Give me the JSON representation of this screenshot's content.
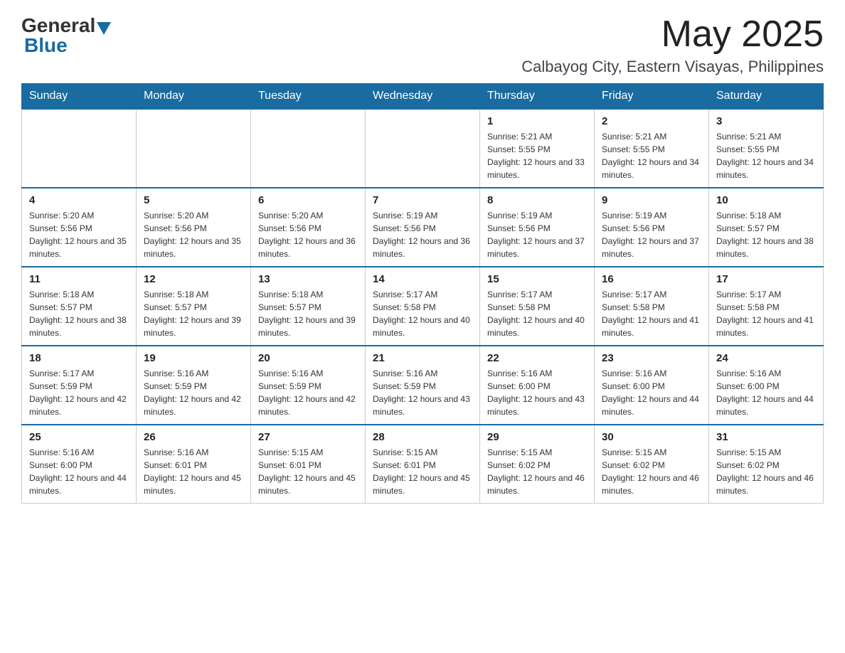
{
  "header": {
    "logo_general": "General",
    "logo_blue": "Blue",
    "month_title": "May 2025",
    "location": "Calbayog City, Eastern Visayas, Philippines"
  },
  "weekdays": [
    "Sunday",
    "Monday",
    "Tuesday",
    "Wednesday",
    "Thursday",
    "Friday",
    "Saturday"
  ],
  "weeks": [
    [
      {
        "day": "",
        "sunrise": "",
        "sunset": "",
        "daylight": ""
      },
      {
        "day": "",
        "sunrise": "",
        "sunset": "",
        "daylight": ""
      },
      {
        "day": "",
        "sunrise": "",
        "sunset": "",
        "daylight": ""
      },
      {
        "day": "",
        "sunrise": "",
        "sunset": "",
        "daylight": ""
      },
      {
        "day": "1",
        "sunrise": "Sunrise: 5:21 AM",
        "sunset": "Sunset: 5:55 PM",
        "daylight": "Daylight: 12 hours and 33 minutes."
      },
      {
        "day": "2",
        "sunrise": "Sunrise: 5:21 AM",
        "sunset": "Sunset: 5:55 PM",
        "daylight": "Daylight: 12 hours and 34 minutes."
      },
      {
        "day": "3",
        "sunrise": "Sunrise: 5:21 AM",
        "sunset": "Sunset: 5:55 PM",
        "daylight": "Daylight: 12 hours and 34 minutes."
      }
    ],
    [
      {
        "day": "4",
        "sunrise": "Sunrise: 5:20 AM",
        "sunset": "Sunset: 5:56 PM",
        "daylight": "Daylight: 12 hours and 35 minutes."
      },
      {
        "day": "5",
        "sunrise": "Sunrise: 5:20 AM",
        "sunset": "Sunset: 5:56 PM",
        "daylight": "Daylight: 12 hours and 35 minutes."
      },
      {
        "day": "6",
        "sunrise": "Sunrise: 5:20 AM",
        "sunset": "Sunset: 5:56 PM",
        "daylight": "Daylight: 12 hours and 36 minutes."
      },
      {
        "day": "7",
        "sunrise": "Sunrise: 5:19 AM",
        "sunset": "Sunset: 5:56 PM",
        "daylight": "Daylight: 12 hours and 36 minutes."
      },
      {
        "day": "8",
        "sunrise": "Sunrise: 5:19 AM",
        "sunset": "Sunset: 5:56 PM",
        "daylight": "Daylight: 12 hours and 37 minutes."
      },
      {
        "day": "9",
        "sunrise": "Sunrise: 5:19 AM",
        "sunset": "Sunset: 5:56 PM",
        "daylight": "Daylight: 12 hours and 37 minutes."
      },
      {
        "day": "10",
        "sunrise": "Sunrise: 5:18 AM",
        "sunset": "Sunset: 5:57 PM",
        "daylight": "Daylight: 12 hours and 38 minutes."
      }
    ],
    [
      {
        "day": "11",
        "sunrise": "Sunrise: 5:18 AM",
        "sunset": "Sunset: 5:57 PM",
        "daylight": "Daylight: 12 hours and 38 minutes."
      },
      {
        "day": "12",
        "sunrise": "Sunrise: 5:18 AM",
        "sunset": "Sunset: 5:57 PM",
        "daylight": "Daylight: 12 hours and 39 minutes."
      },
      {
        "day": "13",
        "sunrise": "Sunrise: 5:18 AM",
        "sunset": "Sunset: 5:57 PM",
        "daylight": "Daylight: 12 hours and 39 minutes."
      },
      {
        "day": "14",
        "sunrise": "Sunrise: 5:17 AM",
        "sunset": "Sunset: 5:58 PM",
        "daylight": "Daylight: 12 hours and 40 minutes."
      },
      {
        "day": "15",
        "sunrise": "Sunrise: 5:17 AM",
        "sunset": "Sunset: 5:58 PM",
        "daylight": "Daylight: 12 hours and 40 minutes."
      },
      {
        "day": "16",
        "sunrise": "Sunrise: 5:17 AM",
        "sunset": "Sunset: 5:58 PM",
        "daylight": "Daylight: 12 hours and 41 minutes."
      },
      {
        "day": "17",
        "sunrise": "Sunrise: 5:17 AM",
        "sunset": "Sunset: 5:58 PM",
        "daylight": "Daylight: 12 hours and 41 minutes."
      }
    ],
    [
      {
        "day": "18",
        "sunrise": "Sunrise: 5:17 AM",
        "sunset": "Sunset: 5:59 PM",
        "daylight": "Daylight: 12 hours and 42 minutes."
      },
      {
        "day": "19",
        "sunrise": "Sunrise: 5:16 AM",
        "sunset": "Sunset: 5:59 PM",
        "daylight": "Daylight: 12 hours and 42 minutes."
      },
      {
        "day": "20",
        "sunrise": "Sunrise: 5:16 AM",
        "sunset": "Sunset: 5:59 PM",
        "daylight": "Daylight: 12 hours and 42 minutes."
      },
      {
        "day": "21",
        "sunrise": "Sunrise: 5:16 AM",
        "sunset": "Sunset: 5:59 PM",
        "daylight": "Daylight: 12 hours and 43 minutes."
      },
      {
        "day": "22",
        "sunrise": "Sunrise: 5:16 AM",
        "sunset": "Sunset: 6:00 PM",
        "daylight": "Daylight: 12 hours and 43 minutes."
      },
      {
        "day": "23",
        "sunrise": "Sunrise: 5:16 AM",
        "sunset": "Sunset: 6:00 PM",
        "daylight": "Daylight: 12 hours and 44 minutes."
      },
      {
        "day": "24",
        "sunrise": "Sunrise: 5:16 AM",
        "sunset": "Sunset: 6:00 PM",
        "daylight": "Daylight: 12 hours and 44 minutes."
      }
    ],
    [
      {
        "day": "25",
        "sunrise": "Sunrise: 5:16 AM",
        "sunset": "Sunset: 6:00 PM",
        "daylight": "Daylight: 12 hours and 44 minutes."
      },
      {
        "day": "26",
        "sunrise": "Sunrise: 5:16 AM",
        "sunset": "Sunset: 6:01 PM",
        "daylight": "Daylight: 12 hours and 45 minutes."
      },
      {
        "day": "27",
        "sunrise": "Sunrise: 5:15 AM",
        "sunset": "Sunset: 6:01 PM",
        "daylight": "Daylight: 12 hours and 45 minutes."
      },
      {
        "day": "28",
        "sunrise": "Sunrise: 5:15 AM",
        "sunset": "Sunset: 6:01 PM",
        "daylight": "Daylight: 12 hours and 45 minutes."
      },
      {
        "day": "29",
        "sunrise": "Sunrise: 5:15 AM",
        "sunset": "Sunset: 6:02 PM",
        "daylight": "Daylight: 12 hours and 46 minutes."
      },
      {
        "day": "30",
        "sunrise": "Sunrise: 5:15 AM",
        "sunset": "Sunset: 6:02 PM",
        "daylight": "Daylight: 12 hours and 46 minutes."
      },
      {
        "day": "31",
        "sunrise": "Sunrise: 5:15 AM",
        "sunset": "Sunset: 6:02 PM",
        "daylight": "Daylight: 12 hours and 46 minutes."
      }
    ]
  ]
}
